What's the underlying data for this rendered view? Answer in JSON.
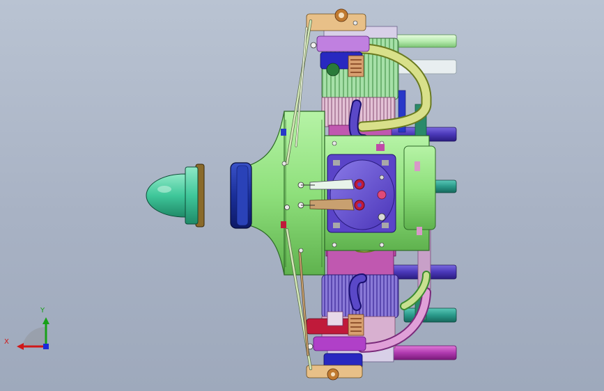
{
  "app": {
    "view": "3d-model-viewport"
  },
  "triad": {
    "x_label": "X",
    "y_label": "Y",
    "x_color": "#d01818",
    "y_color": "#18a018",
    "z_color": "#1a2ad8"
  },
  "model": {
    "colors": {
      "crankcase": "#8fe07c",
      "crankcase_dark": "#5fb24e",
      "spinner": "#3fc79a",
      "spinner_dark": "#1f8a68",
      "prop_hub": "#1a2f9a",
      "prop_washer": "#8a6a2a",
      "cylinder_front": "#6a54d8",
      "cylinder_green": "#9fe0a0",
      "cylinder_purple": "#b49ad6",
      "fins_pink": "#d8b2c8",
      "head_magenta": "#c04aa8",
      "pipe_yellow": "#d8e08a",
      "pipe_purple": "#4a38b8",
      "pipe_teal": "#2a9a8a",
      "pipe_light_green": "#b8ecb0",
      "rocker_red": "#c01a3a",
      "rocker_blue": "#2020b0",
      "rocker_violet": "#a040c0",
      "pushrod": "#d4e8b8",
      "screw": "#333333"
    }
  }
}
